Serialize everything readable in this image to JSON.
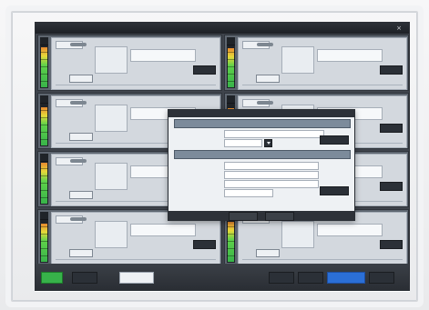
{
  "window": {
    "title": "",
    "close_glyph": "×"
  },
  "channels": [
    {
      "name": "",
      "status": "",
      "button": "",
      "small_button": "",
      "meter_level": 0.82
    },
    {
      "name": "",
      "status": "",
      "button": "",
      "small_button": "",
      "meter_level": 0.8
    },
    {
      "name": "",
      "status": "",
      "button": "",
      "small_button": "",
      "meter_level": 0.78
    },
    {
      "name": "",
      "status": "",
      "button": "",
      "small_button": "",
      "meter_level": 0.76
    },
    {
      "name": "",
      "status": "",
      "button": "",
      "small_button": "",
      "meter_level": 0.84
    },
    {
      "name": "",
      "status": "",
      "button": "",
      "small_button": "",
      "meter_level": 0.79
    },
    {
      "name": "",
      "status": "",
      "button": "",
      "small_button": "",
      "meter_level": 0.77
    },
    {
      "name": "",
      "status": "",
      "button": "",
      "small_button": "",
      "meter_level": 0.81
    }
  ],
  "dialog": {
    "title": "",
    "section_1": "",
    "section_2": "",
    "fields_1": [
      {
        "label": "",
        "value": ""
      },
      {
        "label": "",
        "value": ""
      }
    ],
    "fields_2": [
      {
        "label": "",
        "value": ""
      },
      {
        "label": "",
        "value": ""
      },
      {
        "label": "",
        "value": ""
      },
      {
        "label": "",
        "value": ""
      }
    ],
    "btn_1": "",
    "btn_2": "",
    "footer_1": "",
    "footer_2": ""
  },
  "bottom_bar": {
    "b1": "",
    "b2": "",
    "b3": "",
    "b4": "",
    "b5": "",
    "b6": "",
    "b7": ""
  },
  "colors": {
    "accent_green": "#37b24a",
    "accent_blue": "#2b6fd6",
    "screen_bg": "#3f444c"
  }
}
